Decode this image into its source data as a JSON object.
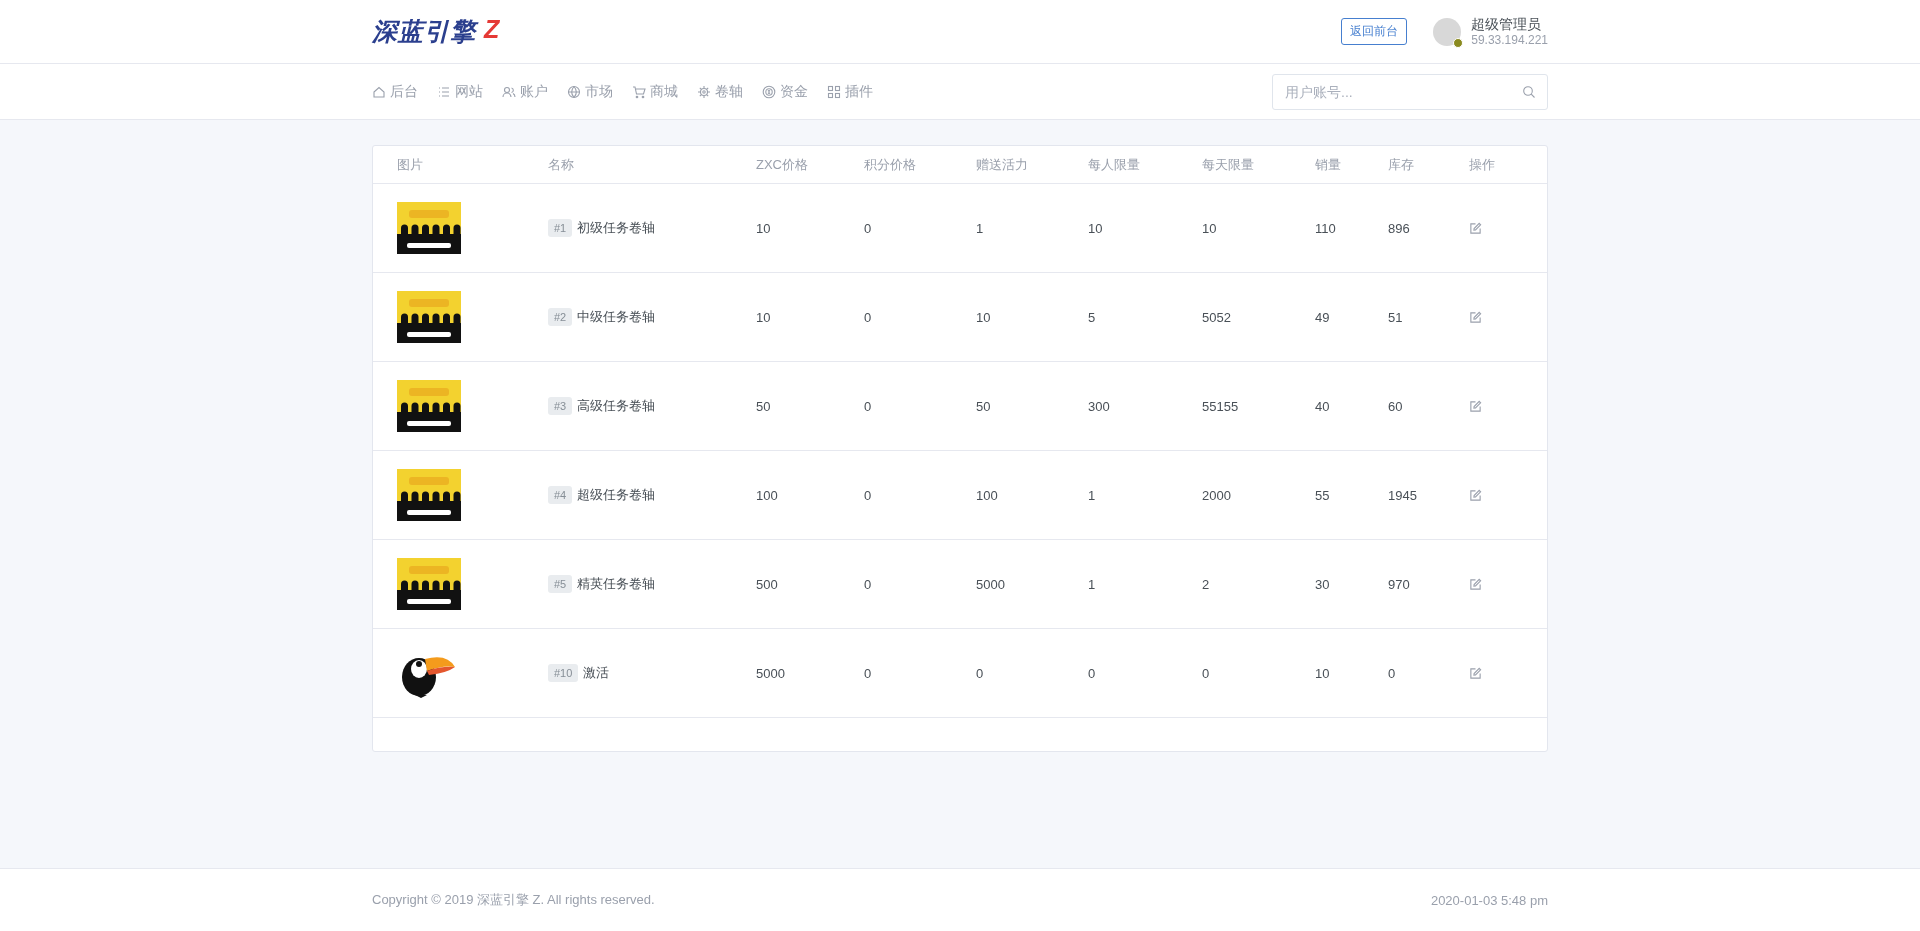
{
  "header": {
    "logo": {
      "text": "深蓝引擎",
      "mark": "Z"
    },
    "back_button": "返回前台",
    "user": {
      "name": "超级管理员",
      "ip": "59.33.194.221",
      "online": true
    }
  },
  "nav": {
    "items": [
      {
        "label": "后台"
      },
      {
        "label": "网站"
      },
      {
        "label": "账户"
      },
      {
        "label": "市场"
      },
      {
        "label": "商城"
      },
      {
        "label": "卷轴"
      },
      {
        "label": "资金"
      },
      {
        "label": "插件"
      }
    ],
    "search": {
      "placeholder": "用户账号..."
    }
  },
  "table": {
    "columns": [
      "图片",
      "名称",
      "ZXC价格",
      "积分价格",
      "赠送活力",
      "每人限量",
      "每天限量",
      "销量",
      "库存",
      "操作"
    ],
    "rows": [
      {
        "image": {
          "kind": "card"
        },
        "id": "#1",
        "name": "初级任务卷轴",
        "values": [
          "10",
          "0",
          "1",
          "10",
          "10",
          "110",
          "896"
        ]
      },
      {
        "image": {
          "kind": "card"
        },
        "id": "#2",
        "name": "中级任务卷轴",
        "values": [
          "10",
          "0",
          "10",
          "5",
          "5052",
          "49",
          "51"
        ]
      },
      {
        "image": {
          "kind": "card"
        },
        "id": "#3",
        "name": "高级任务卷轴",
        "values": [
          "50",
          "0",
          "50",
          "300",
          "55155",
          "40",
          "60"
        ]
      },
      {
        "image": {
          "kind": "card"
        },
        "id": "#4",
        "name": "超级任务卷轴",
        "values": [
          "100",
          "0",
          "100",
          "1",
          "2000",
          "55",
          "1945"
        ]
      },
      {
        "image": {
          "kind": "card"
        },
        "id": "#5",
        "name": "精英任务卷轴",
        "values": [
          "500",
          "0",
          "5000",
          "1",
          "2",
          "30",
          "970"
        ]
      },
      {
        "image": {
          "kind": "bird"
        },
        "id": "#10",
        "name": "激活",
        "values": [
          "5000",
          "0",
          "0",
          "0",
          "0",
          "10",
          "0"
        ]
      }
    ]
  },
  "footer": {
    "copyright": "Copyright © 2019 深蓝引擎 Z. All rights reserved.",
    "datetime": "2020-01-03 5:48 pm"
  }
}
